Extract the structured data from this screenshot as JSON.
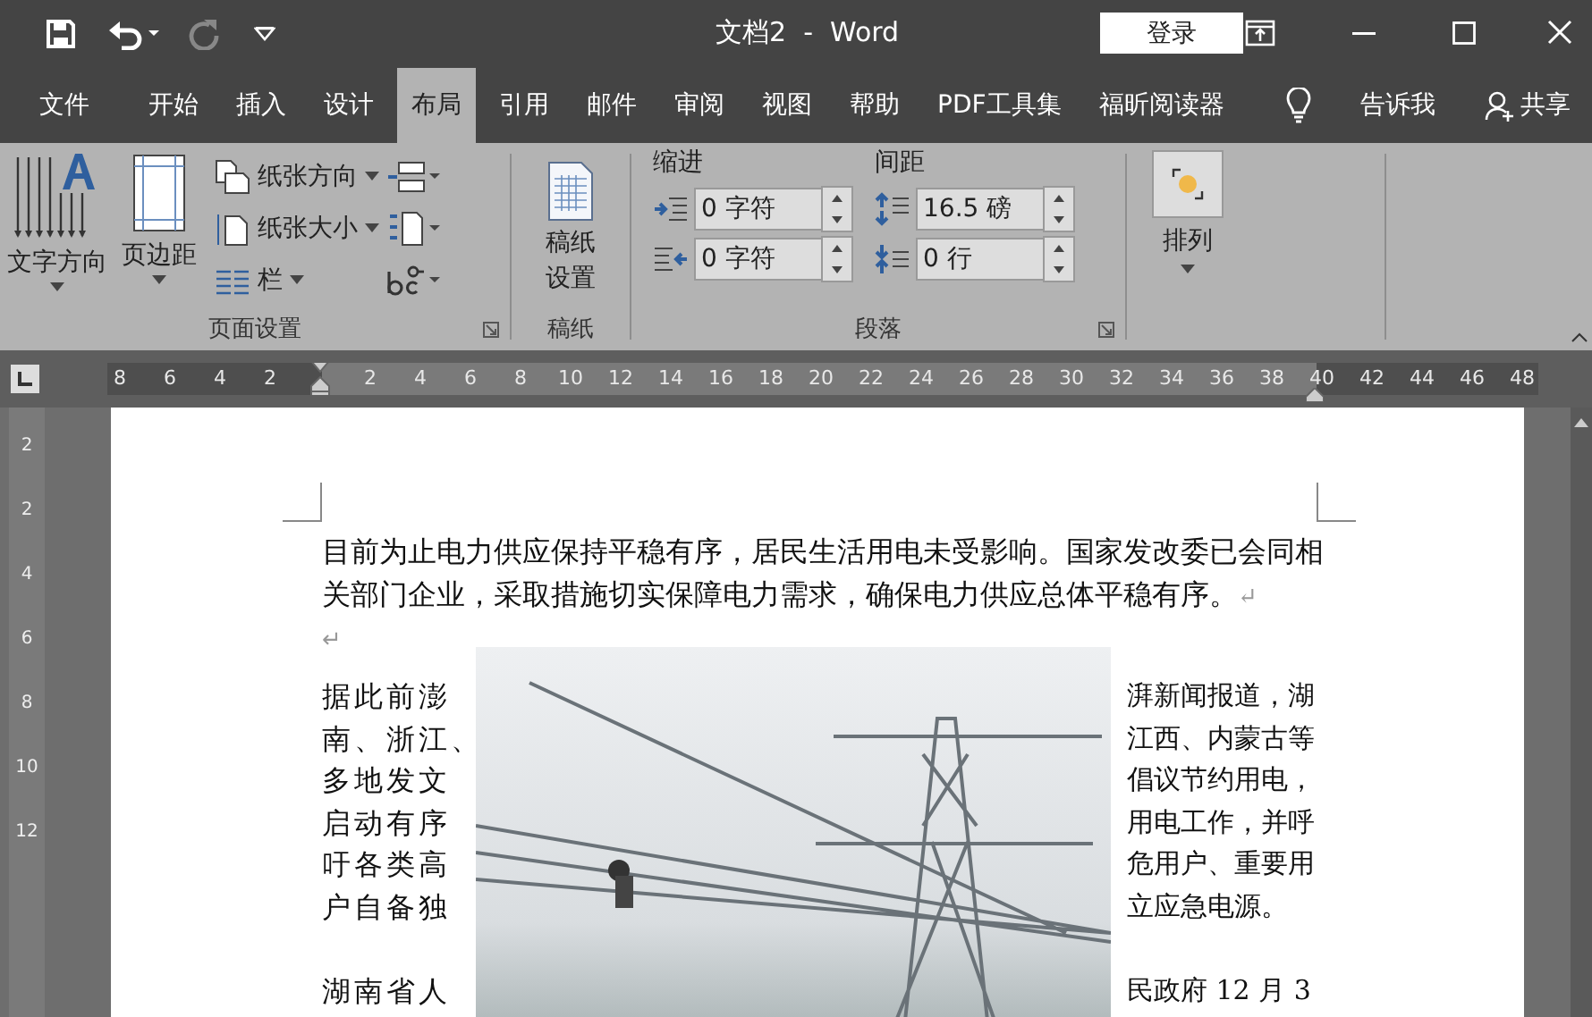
{
  "title_bar": {
    "title": "文档2  -  Word",
    "login_button": "登录"
  },
  "tabs": [
    {
      "label": "文件",
      "selected": false
    },
    {
      "label": "开始",
      "selected": false
    },
    {
      "label": "插入",
      "selected": false
    },
    {
      "label": "设计",
      "selected": false
    },
    {
      "label": "布局",
      "selected": true
    },
    {
      "label": "引用",
      "selected": false
    },
    {
      "label": "邮件",
      "selected": false
    },
    {
      "label": "审阅",
      "selected": false
    },
    {
      "label": "视图",
      "selected": false
    },
    {
      "label": "帮助",
      "selected": false
    },
    {
      "label": "PDF工具集",
      "selected": false
    },
    {
      "label": "福昕阅读器",
      "selected": false
    }
  ],
  "tell_me": "告诉我",
  "share": "共享",
  "ribbon": {
    "page_setup": {
      "text_direction": "文字方向",
      "margins": "页边距",
      "orientation": "纸张方向",
      "size": "纸张大小",
      "columns": "栏",
      "label": "页面设置"
    },
    "draft_paper": {
      "setup": "稿纸设置",
      "label": "稿纸"
    },
    "paragraph": {
      "indent_label": "缩进",
      "spacing_label": "间距",
      "indent_left": "0 字符",
      "indent_right": "0 字符",
      "spacing_before": "16.5 磅",
      "spacing_after": "0 行",
      "label": "段落"
    },
    "arrange": {
      "button": "排列"
    }
  },
  "ruler": {
    "left_numbers": [
      "8",
      "6",
      "4",
      "2"
    ],
    "numbers": [
      "2",
      "4",
      "6",
      "8",
      "10",
      "12",
      "14",
      "16",
      "18",
      "20",
      "22",
      "24",
      "26",
      "28",
      "30",
      "32",
      "34",
      "36",
      "38"
    ],
    "right_numbers": [
      "40",
      "42",
      "44",
      "46",
      "48"
    ]
  },
  "vertical_ruler": [
    "2",
    "2",
    "4",
    "6",
    "8",
    "10",
    "12"
  ],
  "document": {
    "paragraph": {
      "text": "目前为止电力供应保持平稳有序，居民生活用电未受影响。国家发改委已会同相关部门企业，采取措施切实保障电力需求，确保电力供应总体平稳有序。",
      "mark": "↵"
    },
    "empty_line_mark": "↵",
    "column_left": {
      "lines": [
        "据此前澎",
        "南、浙江、",
        "多地发文",
        "启动有序",
        "吁各类高",
        "户自备独"
      ],
      "next_paragraph": "湖南省人"
    },
    "column_right": {
      "lines": [
        "湃新闻报道，湖",
        "江西、内蒙古等",
        "倡议节约用电，",
        "用电工作，并呼",
        "危用户、重要用",
        "立应急电源。"
      ],
      "next_paragraph": "民政府 12 月 3"
    }
  }
}
